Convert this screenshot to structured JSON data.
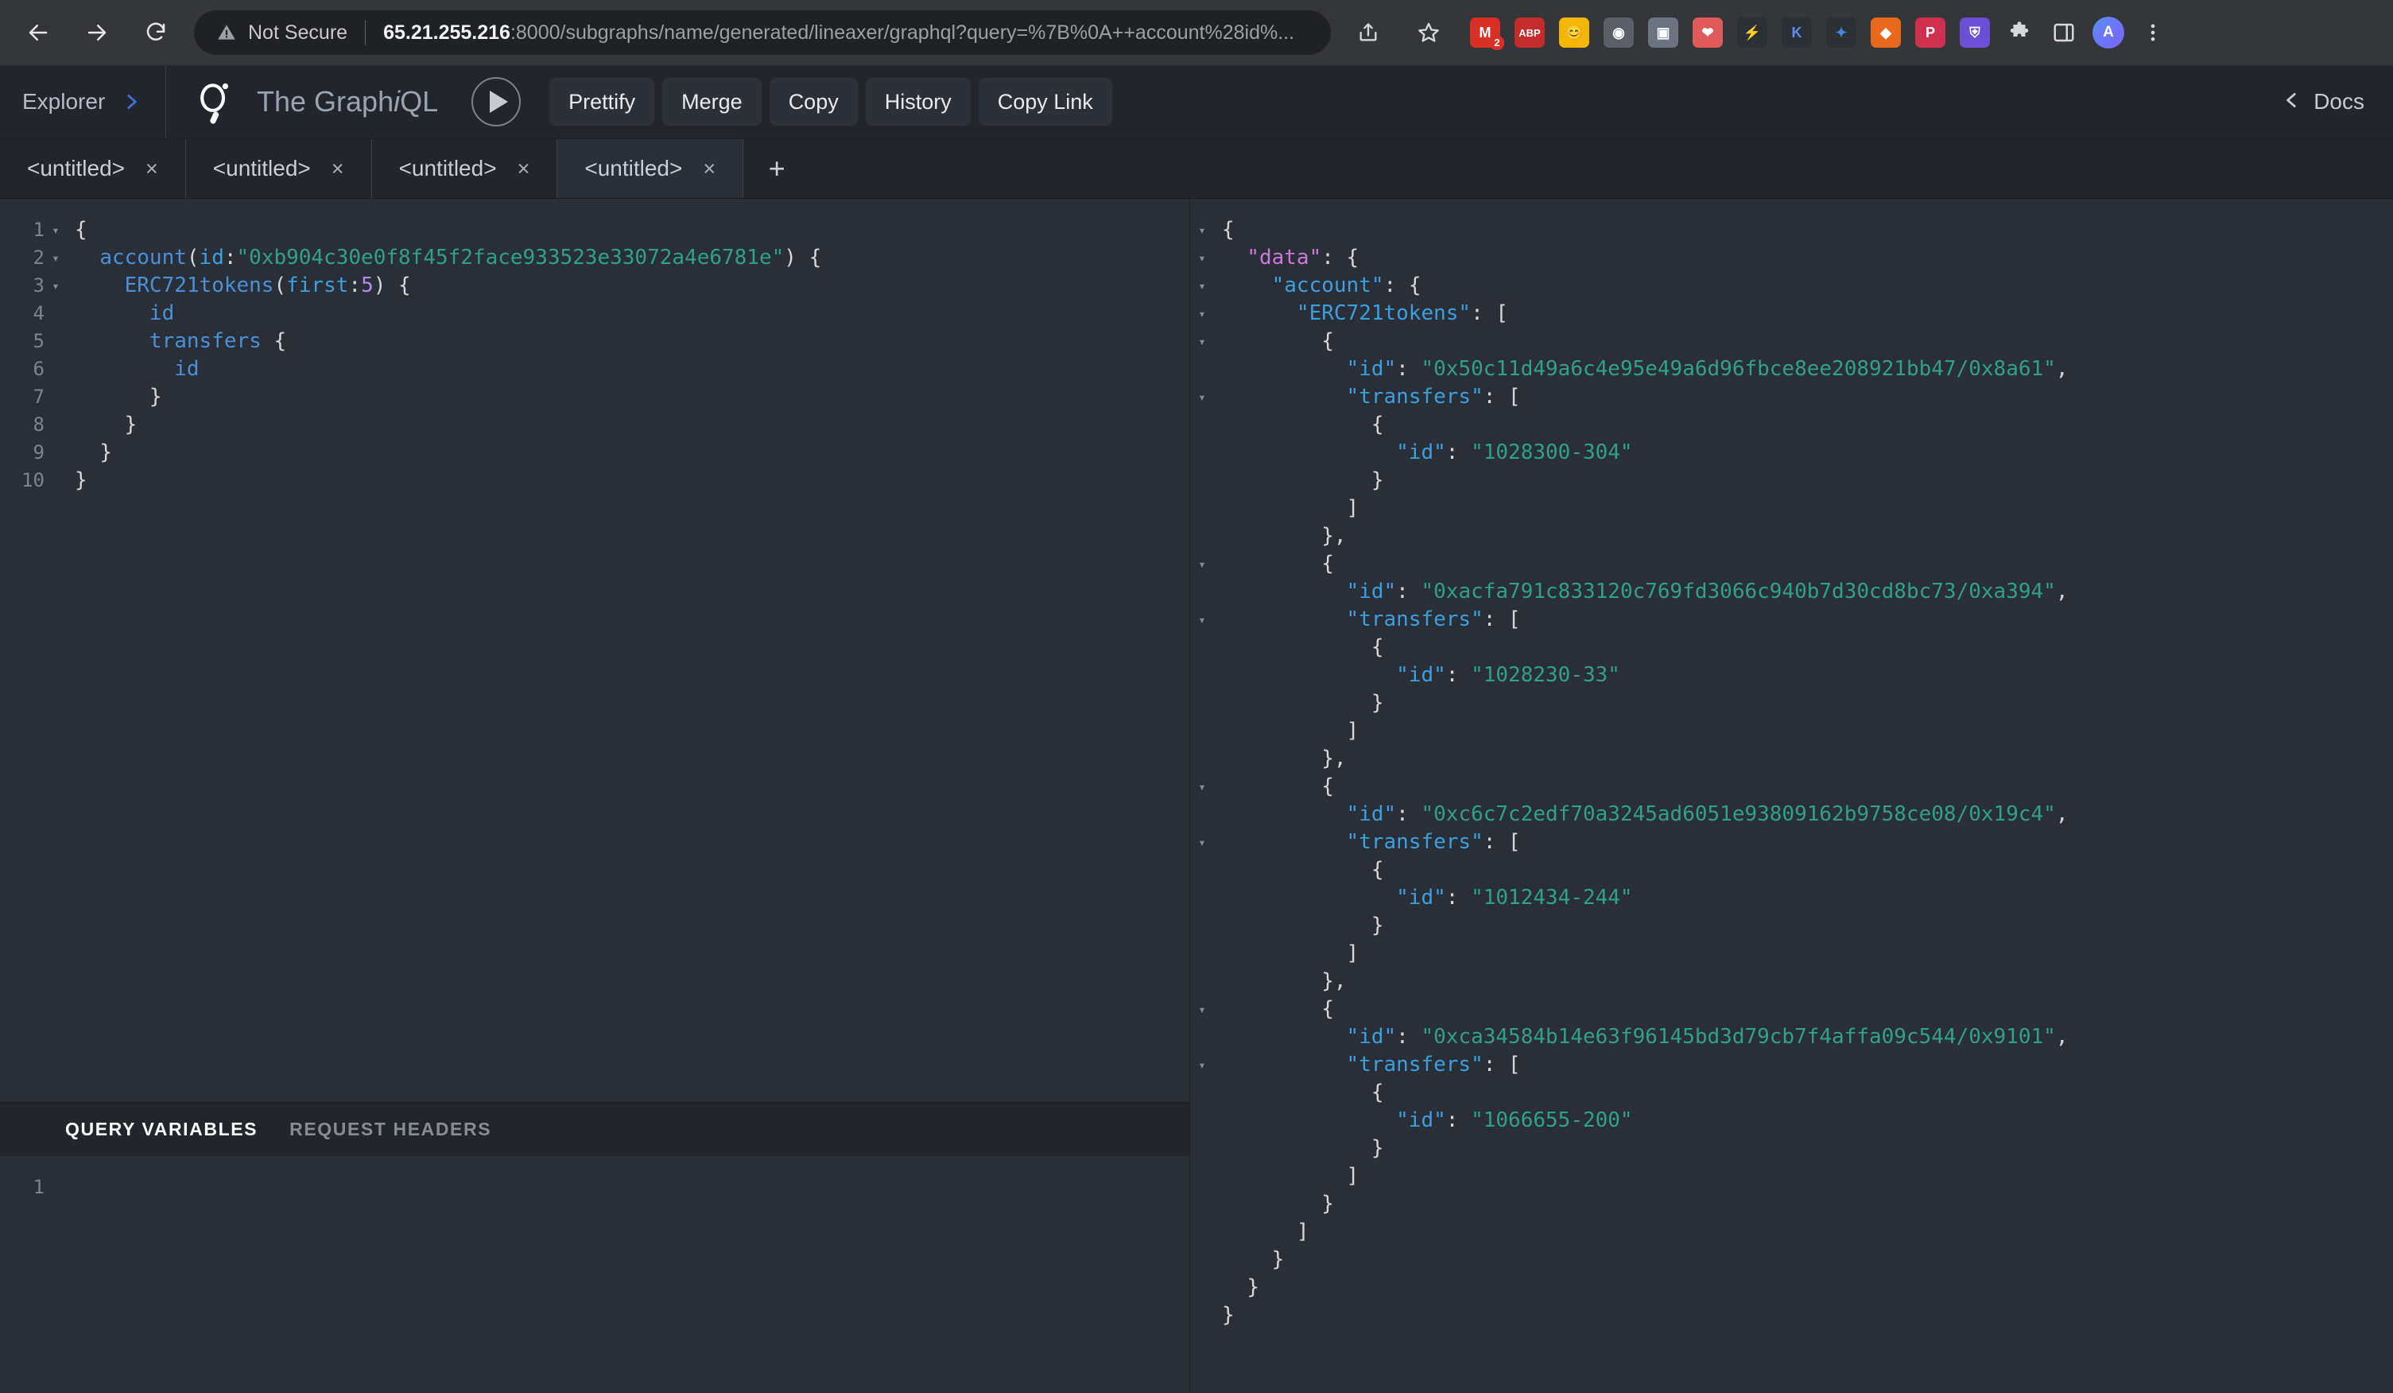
{
  "browser": {
    "back_icon": "arrow-left-icon",
    "forward_icon": "arrow-right-icon",
    "reload_icon": "reload-icon",
    "security_label": "Not Secure",
    "url_host": "65.21.255.216",
    "url_rest": ":8000/subgraphs/name/generated/lineaxer/graphql?query=%7B%0A++account%28id%...",
    "share_icon": "share-icon",
    "bookmark_icon": "star-icon",
    "extensions": [
      {
        "name": "gmail-extension",
        "glyph": "M",
        "color": "#d93025",
        "badge": "2"
      },
      {
        "name": "adblock-extension",
        "glyph": "ABP",
        "color": "#c52d2d",
        "badge": ""
      },
      {
        "name": "emoji-extension",
        "glyph": "😊",
        "color": "#f2b705",
        "badge": ""
      },
      {
        "name": "camera-extension",
        "glyph": "◉",
        "color": "#5a5f68",
        "badge": ""
      },
      {
        "name": "screenshot-extension",
        "glyph": "▣",
        "color": "#6b7280",
        "badge": ""
      },
      {
        "name": "bitwarden-extension",
        "glyph": "❤",
        "color": "#e05a5a",
        "badge": ""
      },
      {
        "name": "lightning-extension",
        "glyph": "⚡",
        "color": "#f0a030",
        "badge": ""
      },
      {
        "name": "kraken-extension",
        "glyph": "K",
        "color": "#5b8def",
        "badge": ""
      },
      {
        "name": "metamask-extension",
        "glyph": "✦",
        "color": "#3f8ae0",
        "badge": ""
      },
      {
        "name": "brave-extension",
        "glyph": "◆",
        "color": "#e8691c",
        "badge": ""
      },
      {
        "name": "pocket-extension",
        "glyph": "P",
        "color": "#d0304f",
        "badge": ""
      },
      {
        "name": "shield-extension",
        "glyph": "⛨",
        "color": "#6b4fd6",
        "badge": ""
      }
    ],
    "puzzle_icon": "puzzle-icon",
    "panel_icon": "side-panel-icon",
    "avatar_initial": "A",
    "menu_icon": "kebab-menu-icon"
  },
  "graphiql": {
    "explorer_label": "Explorer",
    "explorer_chevron": "chevron-right-icon",
    "logo": "graphql-logo",
    "title_plain": "The Graph",
    "title_italic": "i",
    "title_tail": "QL",
    "execute_icon": "play-icon",
    "toolbar_buttons": [
      {
        "name": "prettify-button",
        "label": "Prettify"
      },
      {
        "name": "merge-button",
        "label": "Merge"
      },
      {
        "name": "copy-button",
        "label": "Copy"
      },
      {
        "name": "history-button",
        "label": "History"
      },
      {
        "name": "copy-link-button",
        "label": "Copy Link"
      }
    ],
    "docs_chevron": "chevron-left-icon",
    "docs_label": "Docs"
  },
  "tabs": [
    {
      "label": "<untitled>",
      "close": "×",
      "active": false
    },
    {
      "label": "<untitled>",
      "close": "×",
      "active": false
    },
    {
      "label": "<untitled>",
      "close": "×",
      "active": false
    },
    {
      "label": "<untitled>",
      "close": "×",
      "active": true
    }
  ],
  "tab_add_label": "+",
  "query_editor": {
    "lines": [
      {
        "num": "1",
        "fold": "▾",
        "indent": 0,
        "tokens": [
          {
            "t": "punc",
            "v": "{"
          }
        ]
      },
      {
        "num": "2",
        "fold": "▾",
        "indent": 1,
        "tokens": [
          {
            "t": "field",
            "v": "account"
          },
          {
            "t": "punc",
            "v": "("
          },
          {
            "t": "arg",
            "v": "id"
          },
          {
            "t": "punc",
            "v": ":"
          },
          {
            "t": "str",
            "v": "\"0xb904c30e0f8f45f2face933523e33072a4e6781e\""
          },
          {
            "t": "punc",
            "v": ") {"
          }
        ]
      },
      {
        "num": "3",
        "fold": "▾",
        "indent": 2,
        "tokens": [
          {
            "t": "field",
            "v": "ERC721tokens"
          },
          {
            "t": "punc",
            "v": "("
          },
          {
            "t": "arg",
            "v": "first"
          },
          {
            "t": "punc",
            "v": ":"
          },
          {
            "t": "num",
            "v": "5"
          },
          {
            "t": "punc",
            "v": ") {"
          }
        ]
      },
      {
        "num": "4",
        "fold": "",
        "indent": 3,
        "tokens": [
          {
            "t": "field",
            "v": "id"
          }
        ]
      },
      {
        "num": "5",
        "fold": "",
        "indent": 3,
        "tokens": [
          {
            "t": "field",
            "v": "transfers"
          },
          {
            "t": "punc",
            "v": " {"
          }
        ]
      },
      {
        "num": "6",
        "fold": "",
        "indent": 4,
        "tokens": [
          {
            "t": "field",
            "v": "id"
          }
        ]
      },
      {
        "num": "7",
        "fold": "",
        "indent": 3,
        "tokens": [
          {
            "t": "punc",
            "v": "}"
          }
        ]
      },
      {
        "num": "8",
        "fold": "",
        "indent": 2,
        "tokens": [
          {
            "t": "punc",
            "v": "}"
          }
        ]
      },
      {
        "num": "9",
        "fold": "",
        "indent": 1,
        "tokens": [
          {
            "t": "punc",
            "v": "}"
          }
        ]
      },
      {
        "num": "10",
        "fold": "",
        "indent": 0,
        "tokens": [
          {
            "t": "punc",
            "v": "}"
          }
        ]
      }
    ]
  },
  "variables_panel": {
    "tabs": [
      {
        "name": "tab-query-variables",
        "label": "QUERY VARIABLES",
        "active": true
      },
      {
        "name": "tab-request-headers",
        "label": "REQUEST HEADERS",
        "active": false
      }
    ],
    "line_number": "1",
    "content": ""
  },
  "response": {
    "lines": [
      {
        "fold": "▾",
        "indent": 0,
        "tokens": [
          {
            "t": "punc",
            "v": "{"
          }
        ]
      },
      {
        "fold": "▾",
        "indent": 1,
        "tokens": [
          {
            "t": "key-data",
            "v": "\"data\""
          },
          {
            "t": "punc",
            "v": ": {"
          }
        ]
      },
      {
        "fold": "▾",
        "indent": 2,
        "tokens": [
          {
            "t": "key",
            "v": "\"account\""
          },
          {
            "t": "punc",
            "v": ": {"
          }
        ]
      },
      {
        "fold": "▾",
        "indent": 3,
        "tokens": [
          {
            "t": "key",
            "v": "\"ERC721tokens\""
          },
          {
            "t": "punc",
            "v": ": ["
          }
        ]
      },
      {
        "fold": "▾",
        "indent": 4,
        "tokens": [
          {
            "t": "punc",
            "v": "{"
          }
        ]
      },
      {
        "fold": "",
        "indent": 5,
        "tokens": [
          {
            "t": "key",
            "v": "\"id\""
          },
          {
            "t": "punc",
            "v": ": "
          },
          {
            "t": "val",
            "v": "\"0x50c11d49a6c4e95e49a6d96fbce8ee208921bb47/0x8a61\""
          },
          {
            "t": "punc",
            "v": ","
          }
        ]
      },
      {
        "fold": "▾",
        "indent": 5,
        "tokens": [
          {
            "t": "key",
            "v": "\"transfers\""
          },
          {
            "t": "punc",
            "v": ": ["
          }
        ]
      },
      {
        "fold": "",
        "indent": 6,
        "tokens": [
          {
            "t": "punc",
            "v": "{"
          }
        ]
      },
      {
        "fold": "",
        "indent": 7,
        "tokens": [
          {
            "t": "key",
            "v": "\"id\""
          },
          {
            "t": "punc",
            "v": ": "
          },
          {
            "t": "val",
            "v": "\"1028300-304\""
          }
        ]
      },
      {
        "fold": "",
        "indent": 6,
        "tokens": [
          {
            "t": "punc",
            "v": "}"
          }
        ]
      },
      {
        "fold": "",
        "indent": 5,
        "tokens": [
          {
            "t": "punc",
            "v": "]"
          }
        ]
      },
      {
        "fold": "",
        "indent": 4,
        "tokens": [
          {
            "t": "punc",
            "v": "},"
          }
        ]
      },
      {
        "fold": "▾",
        "indent": 4,
        "tokens": [
          {
            "t": "punc",
            "v": "{"
          }
        ]
      },
      {
        "fold": "",
        "indent": 5,
        "tokens": [
          {
            "t": "key",
            "v": "\"id\""
          },
          {
            "t": "punc",
            "v": ": "
          },
          {
            "t": "val",
            "v": "\"0xacfa791c833120c769fd3066c940b7d30cd8bc73/0xa394\""
          },
          {
            "t": "punc",
            "v": ","
          }
        ]
      },
      {
        "fold": "▾",
        "indent": 5,
        "tokens": [
          {
            "t": "key",
            "v": "\"transfers\""
          },
          {
            "t": "punc",
            "v": ": ["
          }
        ]
      },
      {
        "fold": "",
        "indent": 6,
        "tokens": [
          {
            "t": "punc",
            "v": "{"
          }
        ]
      },
      {
        "fold": "",
        "indent": 7,
        "tokens": [
          {
            "t": "key",
            "v": "\"id\""
          },
          {
            "t": "punc",
            "v": ": "
          },
          {
            "t": "val",
            "v": "\"1028230-33\""
          }
        ]
      },
      {
        "fold": "",
        "indent": 6,
        "tokens": [
          {
            "t": "punc",
            "v": "}"
          }
        ]
      },
      {
        "fold": "",
        "indent": 5,
        "tokens": [
          {
            "t": "punc",
            "v": "]"
          }
        ]
      },
      {
        "fold": "",
        "indent": 4,
        "tokens": [
          {
            "t": "punc",
            "v": "},"
          }
        ]
      },
      {
        "fold": "▾",
        "indent": 4,
        "tokens": [
          {
            "t": "punc",
            "v": "{"
          }
        ]
      },
      {
        "fold": "",
        "indent": 5,
        "tokens": [
          {
            "t": "key",
            "v": "\"id\""
          },
          {
            "t": "punc",
            "v": ": "
          },
          {
            "t": "val",
            "v": "\"0xc6c7c2edf70a3245ad6051e93809162b9758ce08/0x19c4\""
          },
          {
            "t": "punc",
            "v": ","
          }
        ]
      },
      {
        "fold": "▾",
        "indent": 5,
        "tokens": [
          {
            "t": "key",
            "v": "\"transfers\""
          },
          {
            "t": "punc",
            "v": ": ["
          }
        ]
      },
      {
        "fold": "",
        "indent": 6,
        "tokens": [
          {
            "t": "punc",
            "v": "{"
          }
        ]
      },
      {
        "fold": "",
        "indent": 7,
        "tokens": [
          {
            "t": "key",
            "v": "\"id\""
          },
          {
            "t": "punc",
            "v": ": "
          },
          {
            "t": "val",
            "v": "\"1012434-244\""
          }
        ]
      },
      {
        "fold": "",
        "indent": 6,
        "tokens": [
          {
            "t": "punc",
            "v": "}"
          }
        ]
      },
      {
        "fold": "",
        "indent": 5,
        "tokens": [
          {
            "t": "punc",
            "v": "]"
          }
        ]
      },
      {
        "fold": "",
        "indent": 4,
        "tokens": [
          {
            "t": "punc",
            "v": "},"
          }
        ]
      },
      {
        "fold": "▾",
        "indent": 4,
        "tokens": [
          {
            "t": "punc",
            "v": "{"
          }
        ]
      },
      {
        "fold": "",
        "indent": 5,
        "tokens": [
          {
            "t": "key",
            "v": "\"id\""
          },
          {
            "t": "punc",
            "v": ": "
          },
          {
            "t": "val",
            "v": "\"0xca34584b14e63f96145bd3d79cb7f4affa09c544/0x9101\""
          },
          {
            "t": "punc",
            "v": ","
          }
        ]
      },
      {
        "fold": "▾",
        "indent": 5,
        "tokens": [
          {
            "t": "key",
            "v": "\"transfers\""
          },
          {
            "t": "punc",
            "v": ": ["
          }
        ]
      },
      {
        "fold": "",
        "indent": 6,
        "tokens": [
          {
            "t": "punc",
            "v": "{"
          }
        ]
      },
      {
        "fold": "",
        "indent": 7,
        "tokens": [
          {
            "t": "key",
            "v": "\"id\""
          },
          {
            "t": "punc",
            "v": ": "
          },
          {
            "t": "val",
            "v": "\"1066655-200\""
          }
        ]
      },
      {
        "fold": "",
        "indent": 6,
        "tokens": [
          {
            "t": "punc",
            "v": "}"
          }
        ]
      },
      {
        "fold": "",
        "indent": 5,
        "tokens": [
          {
            "t": "punc",
            "v": "]"
          }
        ]
      },
      {
        "fold": "",
        "indent": 4,
        "tokens": [
          {
            "t": "punc",
            "v": "}"
          }
        ]
      },
      {
        "fold": "",
        "indent": 3,
        "tokens": [
          {
            "t": "punc",
            "v": "]"
          }
        ]
      },
      {
        "fold": "",
        "indent": 2,
        "tokens": [
          {
            "t": "punc",
            "v": "}"
          }
        ]
      },
      {
        "fold": "",
        "indent": 1,
        "tokens": [
          {
            "t": "punc",
            "v": "}"
          }
        ]
      },
      {
        "fold": "",
        "indent": 0,
        "tokens": [
          {
            "t": "punc",
            "v": "}"
          }
        ]
      }
    ]
  }
}
